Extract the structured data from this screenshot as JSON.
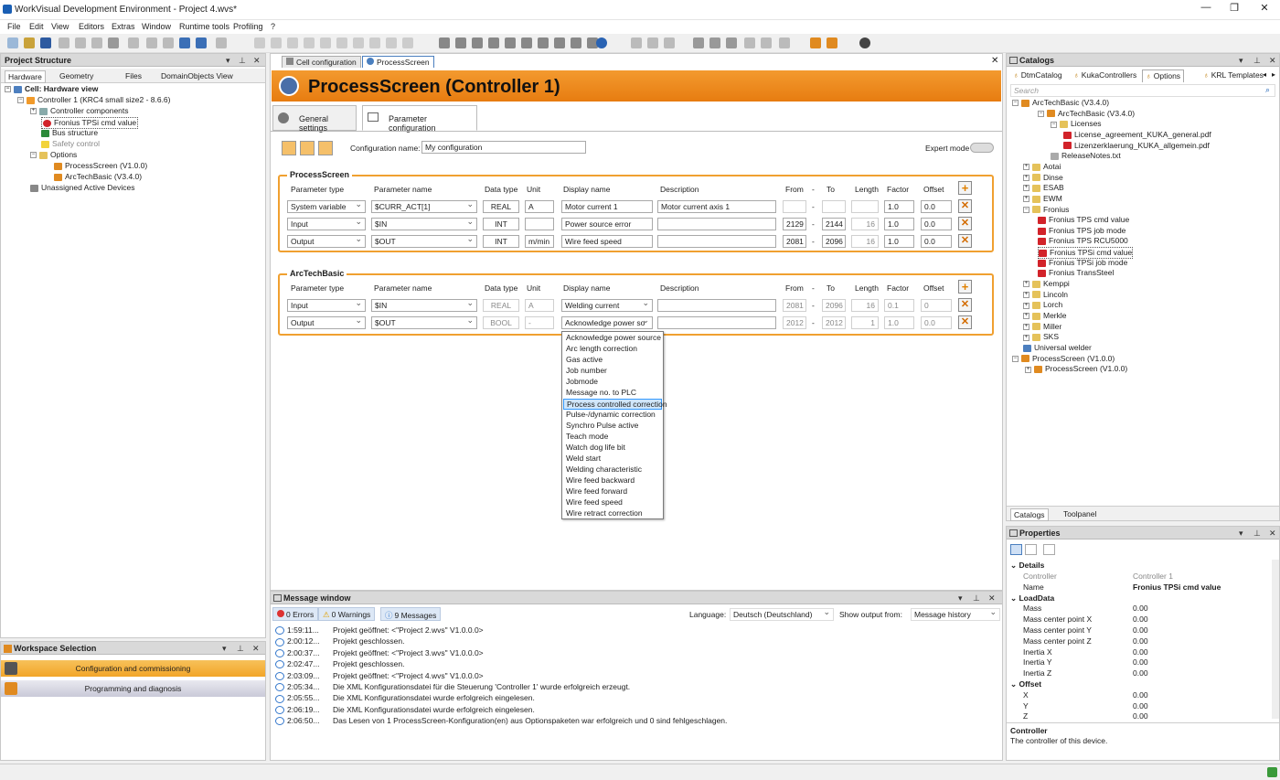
{
  "window": {
    "title": "WorkVisual Development Environment - Project 4.wvs*",
    "min": "—",
    "max": "❐",
    "close": "✕"
  },
  "menu": [
    "File",
    "Edit",
    "View",
    "Editors",
    "Extras",
    "Window",
    "Runtime tools",
    "Profiling",
    "?"
  ],
  "project_structure": {
    "title": "Project Structure",
    "tabs": [
      "Hardware",
      "Geometry",
      "Files",
      "DomainObjects View"
    ],
    "tree": [
      "Cell: Hardware view",
      "Controller 1 (KRC4 small size2 - 8.6.6)",
      "Controller components",
      "Fronius TPSi cmd value",
      "Bus structure",
      "Safety control",
      "Options",
      "ProcessScreen (V1.0.0)",
      "ArcTechBasic (V3.4.0)",
      "Unassigned Active Devices"
    ]
  },
  "workspace": {
    "title": "Workspace Selection",
    "items": [
      "Configuration and commissioning",
      "Programming and diagnosis"
    ]
  },
  "editor": {
    "tabs": [
      "Cell configuration",
      "ProcessScreen"
    ],
    "header": "ProcessScreen (Controller 1)",
    "subtabs": [
      "General settings",
      "Parameter configuration"
    ],
    "config_label": "Configuration name:",
    "config_value": "My configuration",
    "expert_mode": "Expert mode",
    "columns": [
      "Parameter type",
      "Parameter name",
      "Data type",
      "Unit",
      "Display name",
      "Description",
      "From",
      "-",
      "To",
      "Length",
      "Factor",
      "Offset"
    ],
    "sections": [
      {
        "title": "ProcessScreen",
        "rows": [
          {
            "type": "System variable",
            "name": "$CURR_ACT[1]",
            "dtype": "REAL",
            "unit": "A",
            "display": "Motor current 1",
            "desc": "Motor current axis 1",
            "from": "",
            "to": "",
            "length": "",
            "factor": "1.0",
            "offset": "0.0"
          },
          {
            "type": "Input",
            "name": "$IN",
            "dtype": "INT",
            "unit": "",
            "display": "Power source error",
            "desc": "",
            "from": "2129",
            "to": "2144",
            "length": "16",
            "factor": "1.0",
            "offset": "0.0"
          },
          {
            "type": "Output",
            "name": "$OUT",
            "dtype": "INT",
            "unit": "m/min",
            "display": "Wire feed speed",
            "desc": "",
            "from": "2081",
            "to": "2096",
            "length": "16",
            "factor": "1.0",
            "offset": "0.0"
          }
        ]
      },
      {
        "title": "ArcTechBasic",
        "rows": [
          {
            "type": "Input",
            "name": "$IN",
            "dtype": "REAL",
            "unit": "A",
            "display": "Welding current",
            "desc": "",
            "from": "2081",
            "to": "2096",
            "length": "16",
            "factor": "0.1",
            "offset": "0"
          },
          {
            "type": "Output",
            "name": "$OUT",
            "dtype": "BOOL",
            "unit": "-",
            "display": "Acknowledge power so",
            "desc": "",
            "from": "2012",
            "to": "2012",
            "length": "1",
            "factor": "1.0",
            "offset": "0.0"
          }
        ]
      }
    ],
    "dropdown": [
      "Acknowledge power source",
      "Arc length correction",
      "Gas active",
      "Job number",
      "Jobmode",
      "Message no. to PLC",
      "Process controlled correction",
      "Pulse-/dynamic correction",
      "Synchro Pulse active",
      "Teach mode",
      "Watch dog life bit",
      "Weld start",
      "Welding characteristic",
      "Wire feed backward",
      "Wire feed forward",
      "Wire feed speed",
      "Wire retract correction"
    ],
    "dropdown_highlight": 6
  },
  "messages": {
    "title": "Message window",
    "errors": "0 Errors",
    "warnings": "0 Warnings",
    "infos": "9 Messages",
    "language_label": "Language:",
    "language": "Deutsch (Deutschland)",
    "show_label": "Show output from:",
    "show": "Message history",
    "lines": [
      {
        "t": "1:59:11...",
        "m": "Projekt geöffnet: <\"Project 2.wvs\" V1.0.0.0>"
      },
      {
        "t": "2:00:12...",
        "m": "Projekt geschlossen."
      },
      {
        "t": "2:00:37...",
        "m": "Projekt geöffnet: <\"Project 3.wvs\" V1.0.0.0>"
      },
      {
        "t": "2:02:47...",
        "m": "Projekt geschlossen."
      },
      {
        "t": "2:03:09...",
        "m": "Projekt geöffnet: <\"Project 4.wvs\" V1.0.0.0>"
      },
      {
        "t": "2:05:34...",
        "m": "Die XML Konfigurationsdatei für die Steuerung 'Controller 1' wurde erfolgreich erzeugt."
      },
      {
        "t": "2:05:55...",
        "m": "Die XML Konfigurationsdatei wurde erfolgreich eingelesen."
      },
      {
        "t": "2:06:19...",
        "m": "Die XML Konfigurationsdatei wurde erfolgreich eingelesen."
      },
      {
        "t": "2:06:50...",
        "m": "Das Lesen von 1 ProcessScreen-Konfiguration(en) aus Optionspaketen war erfolgreich und 0 sind fehlgeschlagen."
      }
    ]
  },
  "catalogs": {
    "title": "Catalogs",
    "tabs": [
      "DtmCatalog",
      "KukaControllers",
      "Options",
      "KRL Templates"
    ],
    "search": "Search",
    "tree": [
      "ArcTechBasic (V3.4.0)",
      "ArcTechBasic (V3.4.0)",
      "Licenses",
      "License_agreement_KUKA_general.pdf",
      "Lizenzerklaerung_KUKA_allgemein.pdf",
      "ReleaseNotes.txt",
      "Aotai",
      "Dinse",
      "ESAB",
      "EWM",
      "Fronius",
      "Fronius TPS cmd value",
      "Fronius TPS job mode",
      "Fronius TPS RCU5000",
      "Fronius TPSi cmd value",
      "Fronius TPSi job mode",
      "Fronius TransSteel",
      "Kemppi",
      "Lincoln",
      "Lorch",
      "Merkle",
      "Miller",
      "SKS",
      "Universal welder",
      "ProcessScreen (V1.0.0)",
      "ProcessScreen (V1.0.0)"
    ],
    "bottom_tabs": [
      "Catalogs",
      "Toolpanel"
    ]
  },
  "properties": {
    "title": "Properties",
    "details": "Details",
    "rows1": [
      [
        "Controller",
        "Controller 1"
      ],
      [
        "Name",
        "Fronius TPSi cmd value"
      ]
    ],
    "loaddata": "LoadData",
    "rows2": [
      [
        "Mass",
        "0.00"
      ],
      [
        "Mass center point X",
        "0.00"
      ],
      [
        "Mass center point Y",
        "0.00"
      ],
      [
        "Mass center point Z",
        "0.00"
      ],
      [
        "Inertia X",
        "0.00"
      ],
      [
        "Inertia Y",
        "0.00"
      ],
      [
        "Inertia Z",
        "0.00"
      ]
    ],
    "offset": "Offset",
    "rows3": [
      [
        "X",
        "0.00"
      ],
      [
        "Y",
        "0.00"
      ],
      [
        "Z",
        "0.00"
      ]
    ],
    "desc_title": "Controller",
    "desc": "The controller of this device."
  }
}
